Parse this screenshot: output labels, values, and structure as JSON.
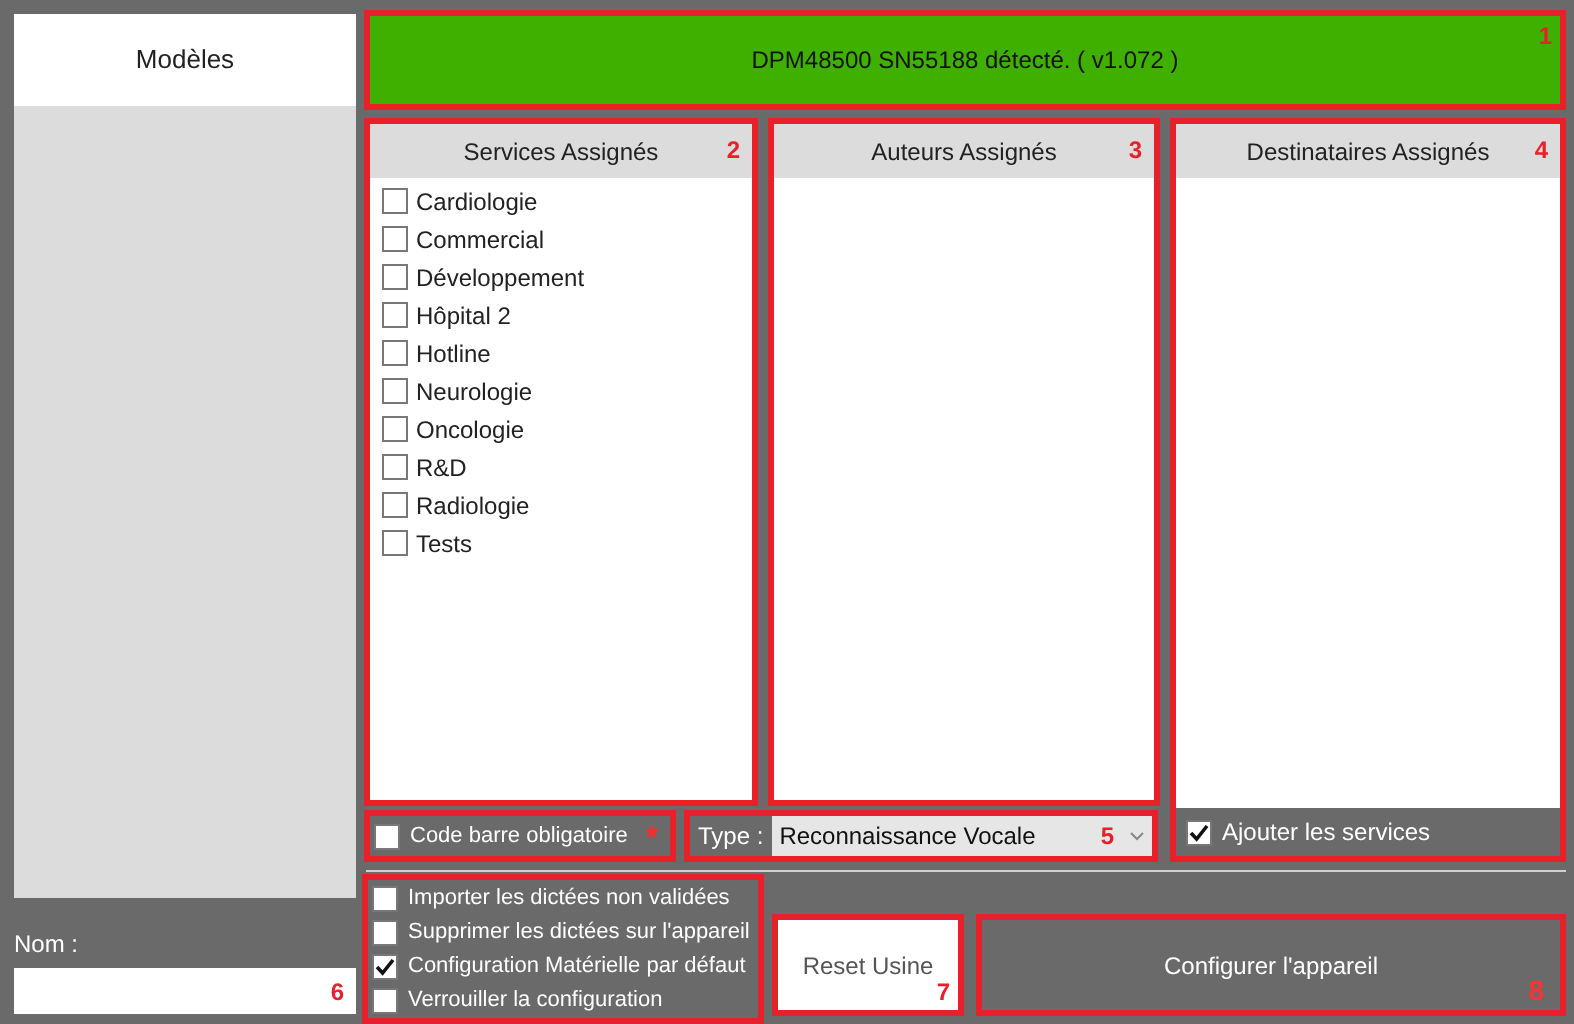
{
  "sidebar": {
    "title": "Modèles",
    "name_label": "Nom :",
    "name_marker": "6"
  },
  "status": {
    "text": "DPM48500 SN55188 détecté. ( v1.072 )",
    "marker": "1"
  },
  "panels": [
    {
      "title": "Services Assignés",
      "marker": "2",
      "items": [
        {
          "label": "Cardiologie",
          "checked": false
        },
        {
          "label": "Commercial",
          "checked": false
        },
        {
          "label": "Développement",
          "checked": false
        },
        {
          "label": "Hôpital 2",
          "checked": false
        },
        {
          "label": "Hotline",
          "checked": false
        },
        {
          "label": "Neurologie",
          "checked": false
        },
        {
          "label": "Oncologie",
          "checked": false
        },
        {
          "label": "R&D",
          "checked": false
        },
        {
          "label": "Radiologie",
          "checked": false
        },
        {
          "label": "Tests",
          "checked": false
        }
      ]
    },
    {
      "title": "Auteurs Assignés",
      "marker": "3"
    },
    {
      "title": "Destinataires Assignés",
      "marker": "4",
      "footer_option": {
        "label": "Ajouter les services",
        "checked": true
      }
    }
  ],
  "barcode_option": {
    "label": "Code barre obligatoire",
    "checked": false,
    "marker": "*"
  },
  "type_field": {
    "label": "Type :",
    "value": "Reconnaissance Vocale",
    "marker": "5"
  },
  "options": [
    {
      "label": "Importer les dictées non validées",
      "checked": false
    },
    {
      "label": "Supprimer les dictées sur l'appareil",
      "checked": false
    },
    {
      "label": "Configuration Matérielle par défaut",
      "checked": true
    },
    {
      "label": "Verrouiller la configuration",
      "checked": false
    }
  ],
  "reset_button": {
    "label": "Reset Usine",
    "marker": "7"
  },
  "configure_button": {
    "label": "Configurer l'appareil",
    "marker": "8"
  }
}
